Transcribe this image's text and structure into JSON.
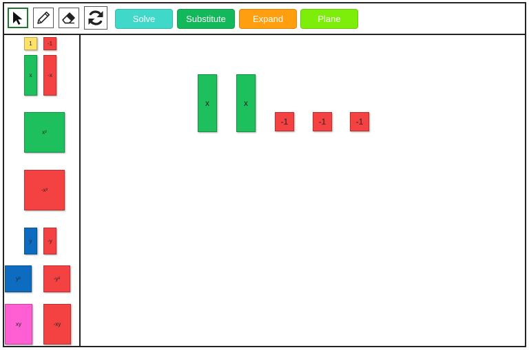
{
  "toolbar": {
    "tools": [
      {
        "name": "select",
        "icon": "cursor-arrow-icon"
      },
      {
        "name": "pencil",
        "icon": "pencil-icon"
      },
      {
        "name": "eraser",
        "icon": "eraser-icon"
      },
      {
        "name": "reset",
        "icon": "refresh-icon"
      }
    ],
    "buttons": {
      "solve": {
        "label": "Solve",
        "color": "#40d9c9"
      },
      "substitute": {
        "label": "Substitute",
        "color": "#13b85a"
      },
      "expand": {
        "label": "Expand",
        "color": "#ff9f0f"
      },
      "plane": {
        "label": "Plane",
        "color": "#7ded0a"
      }
    }
  },
  "palette": {
    "one": "1",
    "neg_one": "-1",
    "x": "x",
    "neg_x": "-x",
    "x_sq": "x²",
    "neg_x_sq": "-x²",
    "y": "y",
    "neg_y": "-y",
    "y_sq": "y²",
    "neg_y_sq": "-y²",
    "xy": "xy",
    "neg_xy": "-xy"
  },
  "colors": {
    "green": "#1ec05e",
    "red": "#f44242",
    "yellow": "#fde26a",
    "blue": "#0e6cc0",
    "pink": "#ff5fd3"
  },
  "workspace": {
    "tiles": [
      "x",
      "x",
      "-1",
      "-1",
      "-1"
    ]
  }
}
